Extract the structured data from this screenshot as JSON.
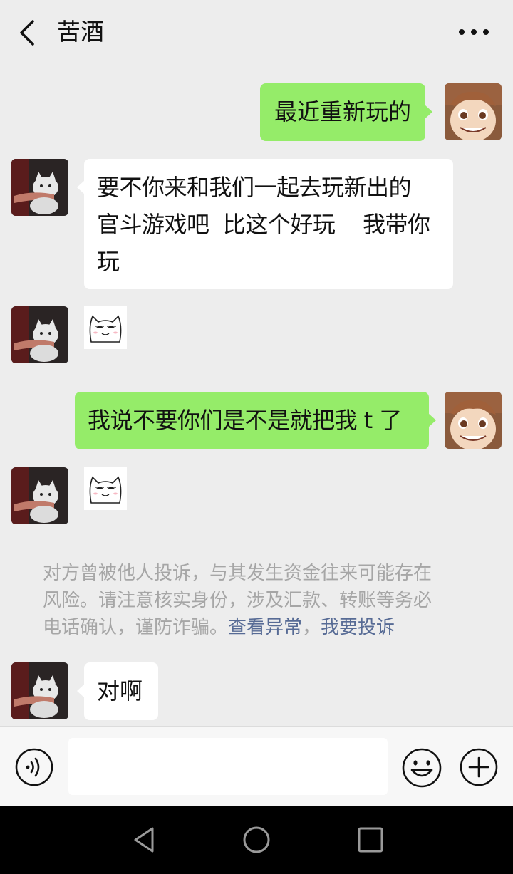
{
  "header": {
    "title": "苦酒"
  },
  "messages": [
    {
      "side": "me",
      "type": "text",
      "text": "最近重新玩的"
    },
    {
      "side": "other",
      "type": "text",
      "lines": [
        "要不你来和我们一起去玩新出的",
        "官斗游戏吧  比这个好玩    我带你",
        "玩"
      ]
    },
    {
      "side": "other",
      "type": "sticker",
      "sticker": "smug-cat-sticker"
    },
    {
      "side": "me",
      "type": "text",
      "text": "我说不要你们是不是就把我 t 了"
    },
    {
      "side": "other",
      "type": "sticker",
      "sticker": "smug-cat-sticker"
    },
    {
      "side": "other",
      "type": "text",
      "text": "对啊"
    }
  ],
  "notice": {
    "line1": "对方曾被他人投诉，与其发生资金往来可能存在",
    "line2": "风险。请注意核实身份，涉及汇款、转账等务必",
    "line3": "电话确认，谨防诈骗。",
    "link1": "查看异常",
    "sep": "，",
    "link2": "我要投诉"
  },
  "input": {
    "value": ""
  },
  "icons": {
    "back": "chevron-left-icon",
    "more": "more-dots-icon",
    "voice": "voice-icon",
    "emoji": "emoji-icon",
    "plus": "plus-icon"
  },
  "colors": {
    "background": "#ededed",
    "my_bubble": "#95ec69",
    "other_bubble": "#ffffff",
    "link": "#576b95",
    "notice_text": "#a6a6a6"
  }
}
